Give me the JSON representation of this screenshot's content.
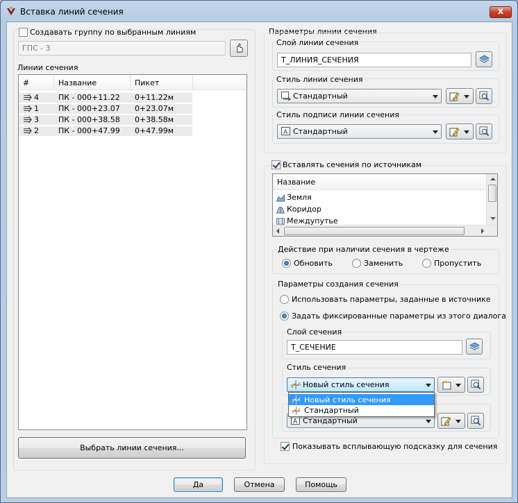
{
  "window": {
    "title": "Вставка линий сечения",
    "close_label": "x"
  },
  "left": {
    "group_checkbox_label": "Создавать группу по выбранным линиям",
    "group_value": "ГПС - 3",
    "section_lines_label": "Линии сечения",
    "columns": [
      "#",
      "Название",
      "Пикет"
    ],
    "rows": [
      {
        "num": "4",
        "name": "ПК - 000+11.22",
        "station": "0+11.22м"
      },
      {
        "num": "1",
        "name": "ПК - 000+23.07",
        "station": "0+23.07м"
      },
      {
        "num": "3",
        "name": "ПК - 000+38.58",
        "station": "0+38.58м"
      },
      {
        "num": "2",
        "name": "ПК - 000+47.99",
        "station": "0+47.99м"
      }
    ],
    "select_button": "Выбрать линии сечения..."
  },
  "right": {
    "line_params_label": "Параметры линии сечения",
    "line_layer_label": "Слой линии сечения",
    "line_layer_value": "Т_ЛИНИЯ_СЕЧЕНИЯ",
    "line_style_label": "Стиль линии сечения",
    "line_style_value": "Стандартный",
    "label_style_label": "Стиль подписи линии сечения",
    "label_style_value": "Стандартный",
    "insert_by_sources_label": "Вставлять сечения по источникам",
    "sources_header": "Название",
    "sources": [
      "Земля",
      "Коридор",
      "Междупутье"
    ],
    "action_label": "Действие при наличии сечения в чертеже",
    "action_options": [
      "Обновить",
      "Заменить",
      "Пропустить"
    ],
    "create_params_label": "Параметры создания сечения",
    "use_source_params": "Использовать параметры, заданные в источнике",
    "use_fixed_params": "Задать фиксированные параметры из этого диалога",
    "section_layer_label": "Слой сечения",
    "section_layer_value": "Т_СЕЧЕНИЕ",
    "section_style_label": "Стиль сечения",
    "section_style_value": "Новый стиль сечения",
    "dropdown_options": [
      "Новый стиль сечения",
      "Стандартный"
    ],
    "section_label_style_value": "Стандартный",
    "tooltip_label": "Показывать всплывающую подсказку для сечения"
  },
  "footer": {
    "ok": "Да",
    "cancel": "Отмена",
    "help": "Помощь"
  },
  "colors": {
    "selection": "#3399ff",
    "title_close": "#c8442a",
    "dialog_bg": "#f0f0f0"
  }
}
